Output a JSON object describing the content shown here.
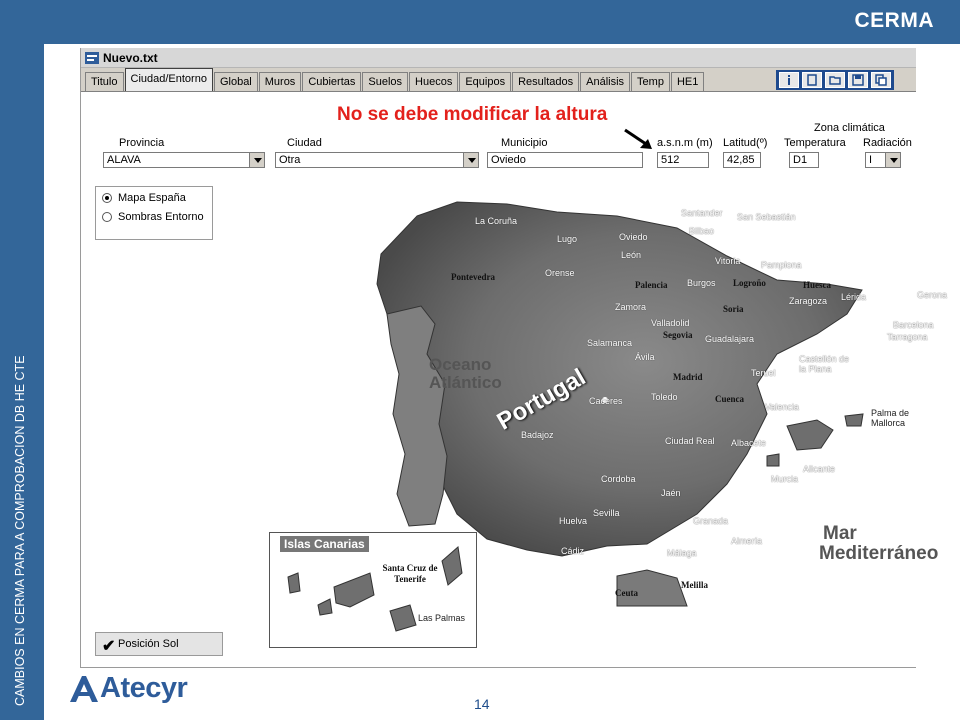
{
  "slide": {
    "brand": "CERMA",
    "side_caption": "CAMBIOS EN CERMA PARA A COMPROBACION DB HE CTE",
    "page_number": "14",
    "logo_text": "Atecyr"
  },
  "window": {
    "title": "Nuevo.txt"
  },
  "tabs": [
    {
      "label": "Titulo"
    },
    {
      "label": "Ciudad/Entorno"
    },
    {
      "label": "Global"
    },
    {
      "label": "Muros"
    },
    {
      "label": "Cubiertas"
    },
    {
      "label": "Suelos"
    },
    {
      "label": "Huecos"
    },
    {
      "label": "Equipos"
    },
    {
      "label": "Resultados"
    },
    {
      "label": "Análisis"
    },
    {
      "label": "Temp"
    },
    {
      "label": "HE1"
    }
  ],
  "active_tab": "Ciudad/Entorno",
  "annotation": "No se debe modificar la altura",
  "form": {
    "provincia_label": "Provincia",
    "provincia_value": "ALAVA",
    "ciudad_label": "Ciudad",
    "ciudad_value": "Otra",
    "municipio_label": "Municipio",
    "municipio_value": "Oviedo",
    "altura_label": "a.s.n.m (m)",
    "altura_value": "512",
    "latitud_label": "Latitud(º)",
    "latitud_value": "42,85",
    "zona_label": "Zona climática",
    "temperatura_label": "Temperatura",
    "temperatura_value": "D1",
    "radiacion_label": "Radiación",
    "radiacion_value": "I"
  },
  "map_options": {
    "option1": "Mapa España",
    "option2": "Sombras Entorno",
    "selected": "Mapa España"
  },
  "sun_button": "Posición Sol",
  "map": {
    "seas": {
      "atlantic_1": "Oceano",
      "atlantic_2": "Atlántico",
      "med_1": "Mar",
      "med_2": "Mediterráneo"
    },
    "portugal": "Portugal",
    "canarias": "Islas Canarias",
    "cities": [
      {
        "name": "La Coruña"
      },
      {
        "name": "Lugo"
      },
      {
        "name": "Oviedo"
      },
      {
        "name": "Santander"
      },
      {
        "name": "Bilbao"
      },
      {
        "name": "San Sebastián"
      },
      {
        "name": "Orense"
      },
      {
        "name": "León"
      },
      {
        "name": "Vitoria"
      },
      {
        "name": "Pamplona"
      },
      {
        "name": "Burgos"
      },
      {
        "name": "Zamora"
      },
      {
        "name": "Valladolid"
      },
      {
        "name": "Zaragoza"
      },
      {
        "name": "Lérida"
      },
      {
        "name": "Gerona"
      },
      {
        "name": "Barcelona"
      },
      {
        "name": "Tarragona"
      },
      {
        "name": "Salamanca"
      },
      {
        "name": "Ávila"
      },
      {
        "name": "Guadalajara"
      },
      {
        "name": "Teruel"
      },
      {
        "name": "Castellón de la Plana"
      },
      {
        "name": "Caceres"
      },
      {
        "name": "Toledo"
      },
      {
        "name": "Valencia"
      },
      {
        "name": "Badajoz"
      },
      {
        "name": "Ciudad Real"
      },
      {
        "name": "Albacete"
      },
      {
        "name": "Alicante"
      },
      {
        "name": "Murcia"
      },
      {
        "name": "Cordoba"
      },
      {
        "name": "Jaén"
      },
      {
        "name": "Sevilla"
      },
      {
        "name": "Granada"
      },
      {
        "name": "Huelva"
      },
      {
        "name": "Almería"
      },
      {
        "name": "Cádiz"
      },
      {
        "name": "Málaga"
      },
      {
        "name": "Palma de Mallorca"
      },
      {
        "name": "Las Palmas"
      }
    ],
    "dark_labels": [
      {
        "name": "Pontevedra"
      },
      {
        "name": "Palencia"
      },
      {
        "name": "Logroño"
      },
      {
        "name": "Huesca"
      },
      {
        "name": "Soria"
      },
      {
        "name": "Segovia"
      },
      {
        "name": "Madrid"
      },
      {
        "name": "Cuenca"
      },
      {
        "name": "Santa Cruz de Tenerife"
      },
      {
        "name": "Melilla"
      },
      {
        "name": "Ceuta"
      }
    ]
  }
}
